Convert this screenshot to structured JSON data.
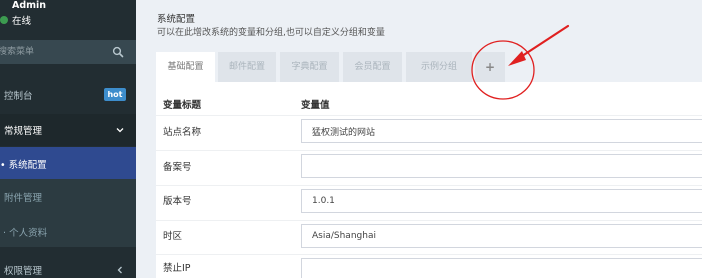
{
  "sidebar": {
    "user": {
      "name": "Admin",
      "status": "在线",
      "status_color": "#3c9b50"
    },
    "search": {
      "placeholder": "搜索菜单"
    },
    "items": [
      {
        "label": "控制台",
        "badge": "hot",
        "badge_color": "#3d8dcc"
      },
      {
        "label": "常规管理",
        "expanded": true
      },
      {
        "label": "系统配置"
      },
      {
        "label": "附件管理"
      },
      {
        "label": "个人资料"
      },
      {
        "label": "权限管理",
        "expanded": false
      }
    ]
  },
  "header": {
    "title": "系统配置",
    "subtitle": "可以在此增改系统的变量和分组,也可以自定义分组和变量"
  },
  "tabs": [
    {
      "label": "基础配置",
      "active": true
    },
    {
      "label": "邮件配置",
      "active": false
    },
    {
      "label": "字典配置",
      "active": false
    },
    {
      "label": "会员配置",
      "active": false
    },
    {
      "label": "示例分组",
      "active": false
    },
    {
      "label": "+",
      "active": false
    }
  ],
  "table": {
    "columns": [
      "变量标题",
      "变量值"
    ],
    "rows": [
      {
        "label": "站点名称",
        "value": "猛权测试的网站"
      },
      {
        "label": "备案号",
        "value": ""
      },
      {
        "label": "版本号",
        "value": "1.0.1"
      },
      {
        "label": "时区",
        "value": "Asia/Shanghai"
      },
      {
        "label": "禁止IP",
        "value": ""
      }
    ]
  },
  "colors": {
    "sidebar_bg": "#222d32",
    "selected_item": "#2f4a90",
    "content_bg": "#ecf0f5",
    "annotation": "#e02020"
  }
}
